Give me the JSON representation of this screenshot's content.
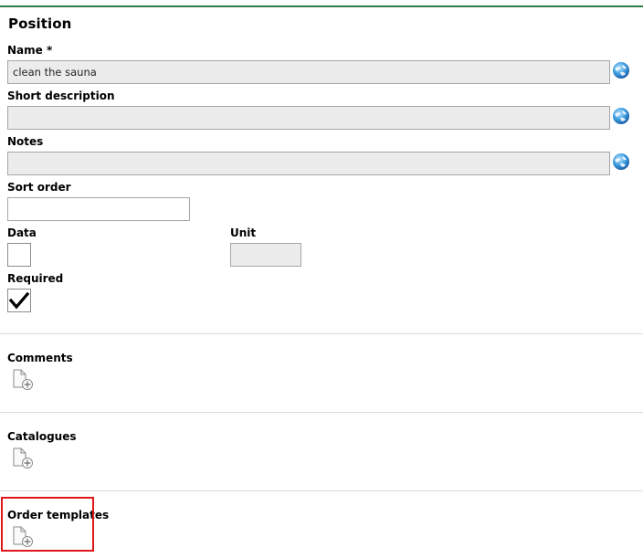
{
  "section": {
    "title": "Position"
  },
  "fields": {
    "name": {
      "label": "Name *",
      "value": "clean the sauna"
    },
    "short_description": {
      "label": "Short description",
      "value": ""
    },
    "notes": {
      "label": "Notes",
      "value": ""
    },
    "sort_order": {
      "label": "Sort order",
      "value": ""
    },
    "data": {
      "label": "Data",
      "checked": false
    },
    "unit": {
      "label": "Unit",
      "value": ""
    },
    "required": {
      "label": "Required",
      "checked": true
    }
  },
  "relations": [
    {
      "label": "Comments",
      "icon": "add-document-icon"
    },
    {
      "label": "Catalogues",
      "icon": "add-document-icon"
    },
    {
      "label": "Order templates",
      "icon": "add-document-icon",
      "highlighted": true
    }
  ],
  "icons": {
    "translate": "globe-icon",
    "check": "checkmark-icon"
  },
  "colors": {
    "top_rule": "#2e7d4f",
    "highlight": "#e0161b",
    "field_disabled": "#ececec"
  }
}
